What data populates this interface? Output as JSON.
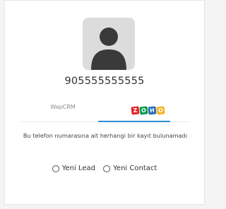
{
  "contact": {
    "phone": "905555555555"
  },
  "tabs": [
    {
      "label": "WapCRM"
    },
    {
      "label": "zoho",
      "logo_letters": [
        "Z",
        "O",
        "H",
        "O"
      ],
      "logo_colors": [
        "#e42527",
        "#089949",
        "#226db4",
        "#f9b21d"
      ]
    }
  ],
  "colors": {
    "accent": "#2c8fd6"
  },
  "message": "Bu telefon numarasına ait herhangi bir kayıt bulunamadı",
  "options": [
    {
      "label": "Yeni Lead",
      "checked": false
    },
    {
      "label": "Yeni Contact",
      "checked": false
    }
  ]
}
